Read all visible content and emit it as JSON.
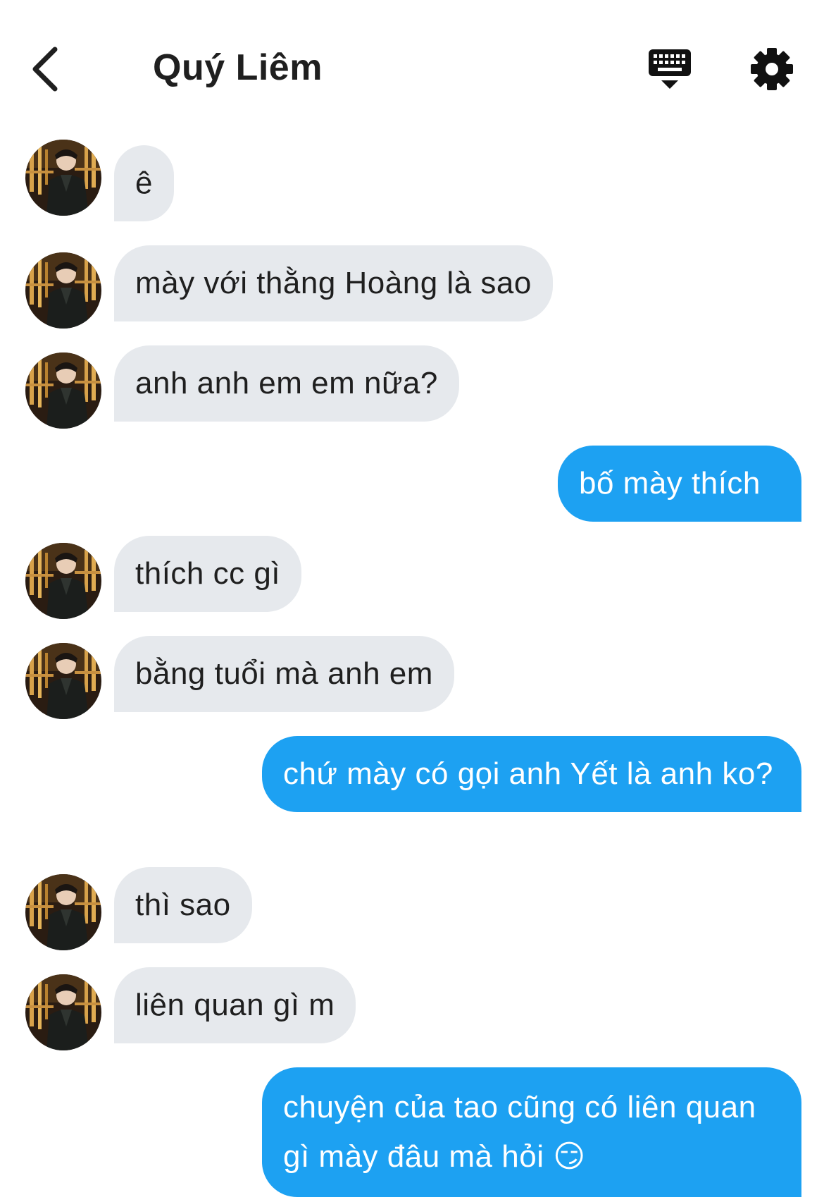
{
  "header": {
    "title": "Quý Liêm",
    "back_icon": "chevron-left-icon",
    "keyboard_icon": "keyboard-icon",
    "settings_icon": "gear-icon"
  },
  "colors": {
    "incoming_bubble": "#e6e9ed",
    "outgoing_bubble": "#1da1f2",
    "text_dark": "#1f1f1f",
    "text_light": "#ffffff"
  },
  "messages": [
    {
      "from": "other",
      "text": "ê"
    },
    {
      "from": "other",
      "text": "mày với thằng Hoàng là sao"
    },
    {
      "from": "other",
      "text": "anh anh em em nữa?"
    },
    {
      "from": "me",
      "text": "bố mày thích"
    },
    {
      "from": "other",
      "text": "thích cc gì"
    },
    {
      "from": "other",
      "text": "bằng tuổi mà anh em"
    },
    {
      "from": "me",
      "text": "chứ mày có gọi anh Yết là anh ko?"
    },
    {
      "from": "other",
      "text": "thì sao"
    },
    {
      "from": "other",
      "text": "liên quan gì m"
    },
    {
      "from": "me",
      "text": "chuyện của tao cũng có liên quan gì mày đâu mà hỏi 😏"
    }
  ]
}
